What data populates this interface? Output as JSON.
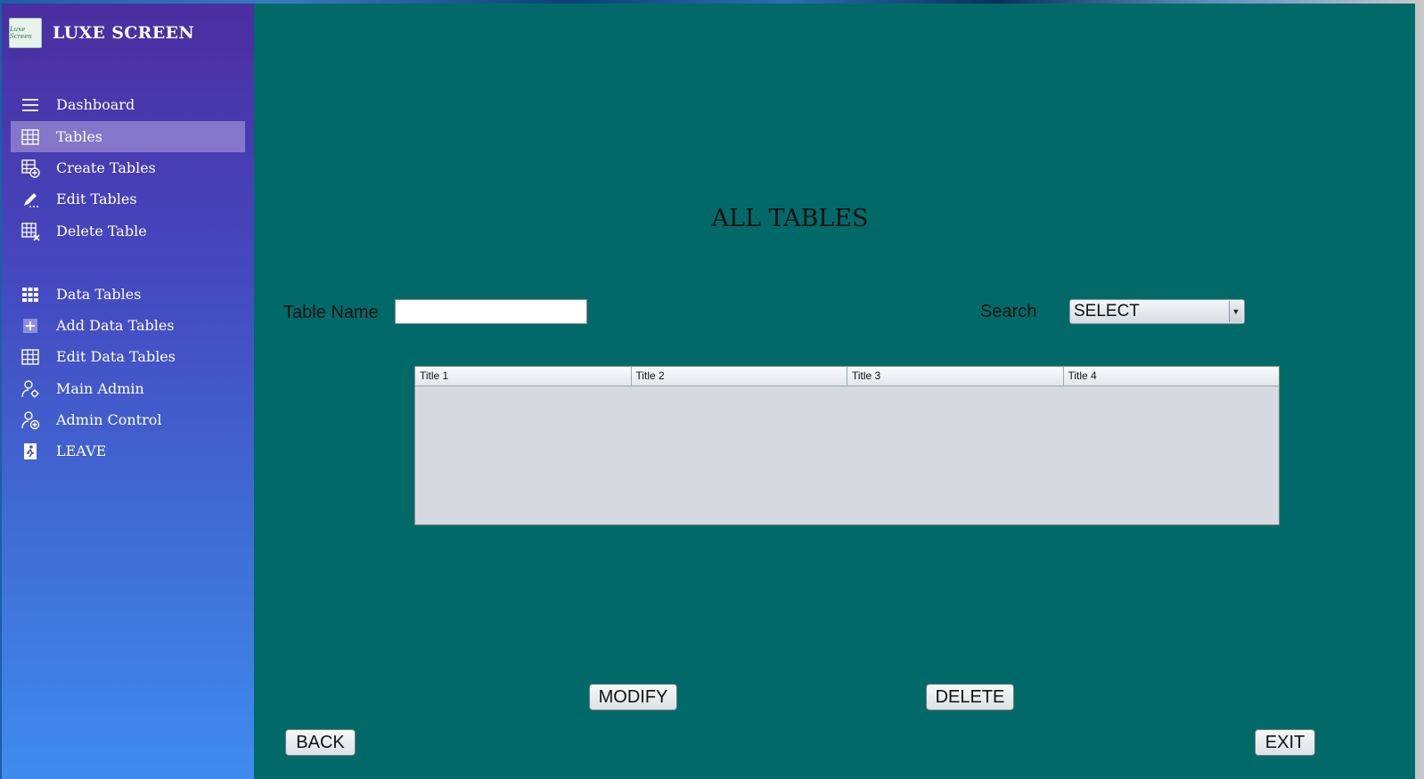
{
  "app": {
    "name": "LUXE SCREEN",
    "logo_text": "Luxe Screen"
  },
  "sidebar": {
    "items": [
      {
        "label": "Dashboard",
        "icon": "menu-icon"
      },
      {
        "label": "Tables",
        "icon": "table-grid-icon",
        "active": true
      },
      {
        "label": "Create Tables",
        "icon": "table-add-icon"
      },
      {
        "label": "Edit Tables",
        "icon": "pencil-icon"
      },
      {
        "label": "Delete Table",
        "icon": "table-delete-icon"
      },
      {
        "label": "Data Tables",
        "icon": "data-grid-icon"
      },
      {
        "label": "Add Data Tables",
        "icon": "plus-square-icon"
      },
      {
        "label": "Edit Data Tables",
        "icon": "table-grid-icon"
      },
      {
        "label": "Main Admin",
        "icon": "user-gear-icon"
      },
      {
        "label": "Admin Control",
        "icon": "user-add-icon"
      },
      {
        "label": "LEAVE",
        "icon": "exit-run-icon"
      }
    ]
  },
  "main": {
    "title": "ALL TABLES",
    "table_name_label": "Table Name",
    "table_name_value": "",
    "search_label": "Search",
    "search_selected": "SELECT",
    "grid": {
      "columns": [
        "Title 1",
        "Title 2",
        "Title 3",
        "Title 4"
      ],
      "rows": []
    },
    "modify_label": "MODIFY",
    "delete_label": "DELETE",
    "back_label": "BACK",
    "exit_label": "EXIT"
  },
  "colors": {
    "content_bg": "#016a68",
    "sidebar_top": "#4b2ea0",
    "sidebar_bottom": "#3f8bef",
    "active_item": "#8477c9"
  }
}
